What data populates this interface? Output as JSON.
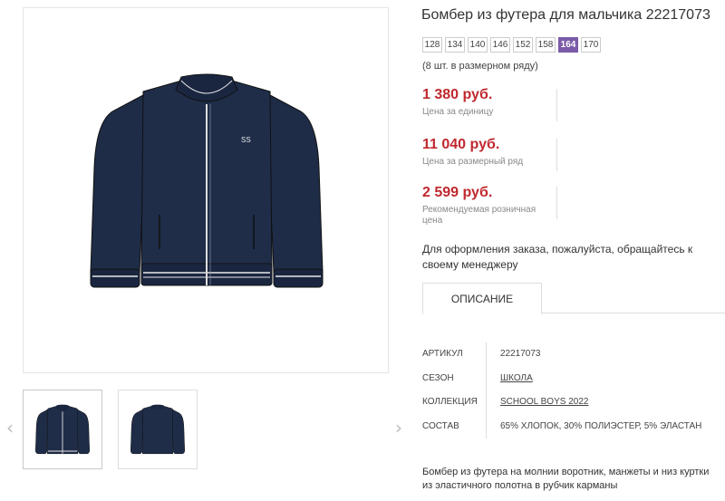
{
  "product": {
    "title": "Бомбер из футера для мальчика 22217073",
    "sizes": [
      "128",
      "134",
      "140",
      "146",
      "152",
      "158",
      "164",
      "170"
    ],
    "selected_size": "164",
    "sizes_note": "(8 шт. в размерном ряду)"
  },
  "prices": [
    {
      "value": "1 380 руб.",
      "caption": "Цена за единицу"
    },
    {
      "value": "11 040 руб.",
      "caption": "Цена за размерный ряд"
    },
    {
      "value": "2 599 руб.",
      "caption": "Рекомендуемая розничная цена"
    }
  ],
  "order_note": "Для оформления заказа, пожалуйста, обращайтесь к своему менеджеру",
  "tabs": {
    "description": "ОПИСАНИЕ"
  },
  "specs": [
    {
      "key": "АРТИКУЛ",
      "value": "22217073"
    },
    {
      "key": "СЕЗОН",
      "value": "ШКОЛА"
    },
    {
      "key": "КОЛЛЕКЦИЯ",
      "value": "SCHOOL BOYS 2022"
    },
    {
      "key": "СОСТАВ",
      "value": "65% ХЛОПОК, 30% ПОЛИЭСТЕР, 5% ЭЛАСТАН"
    }
  ],
  "description": "Бомбер из футера на молнии воротник, манжеты и низ куртки из эластичного полотна в рубчик карманы",
  "gallery": {
    "prev_icon": "‹",
    "next_icon": "›"
  },
  "colors": {
    "accent": "#7a5ba8",
    "price": "#c0282e",
    "jacket": "#1e2c47"
  }
}
